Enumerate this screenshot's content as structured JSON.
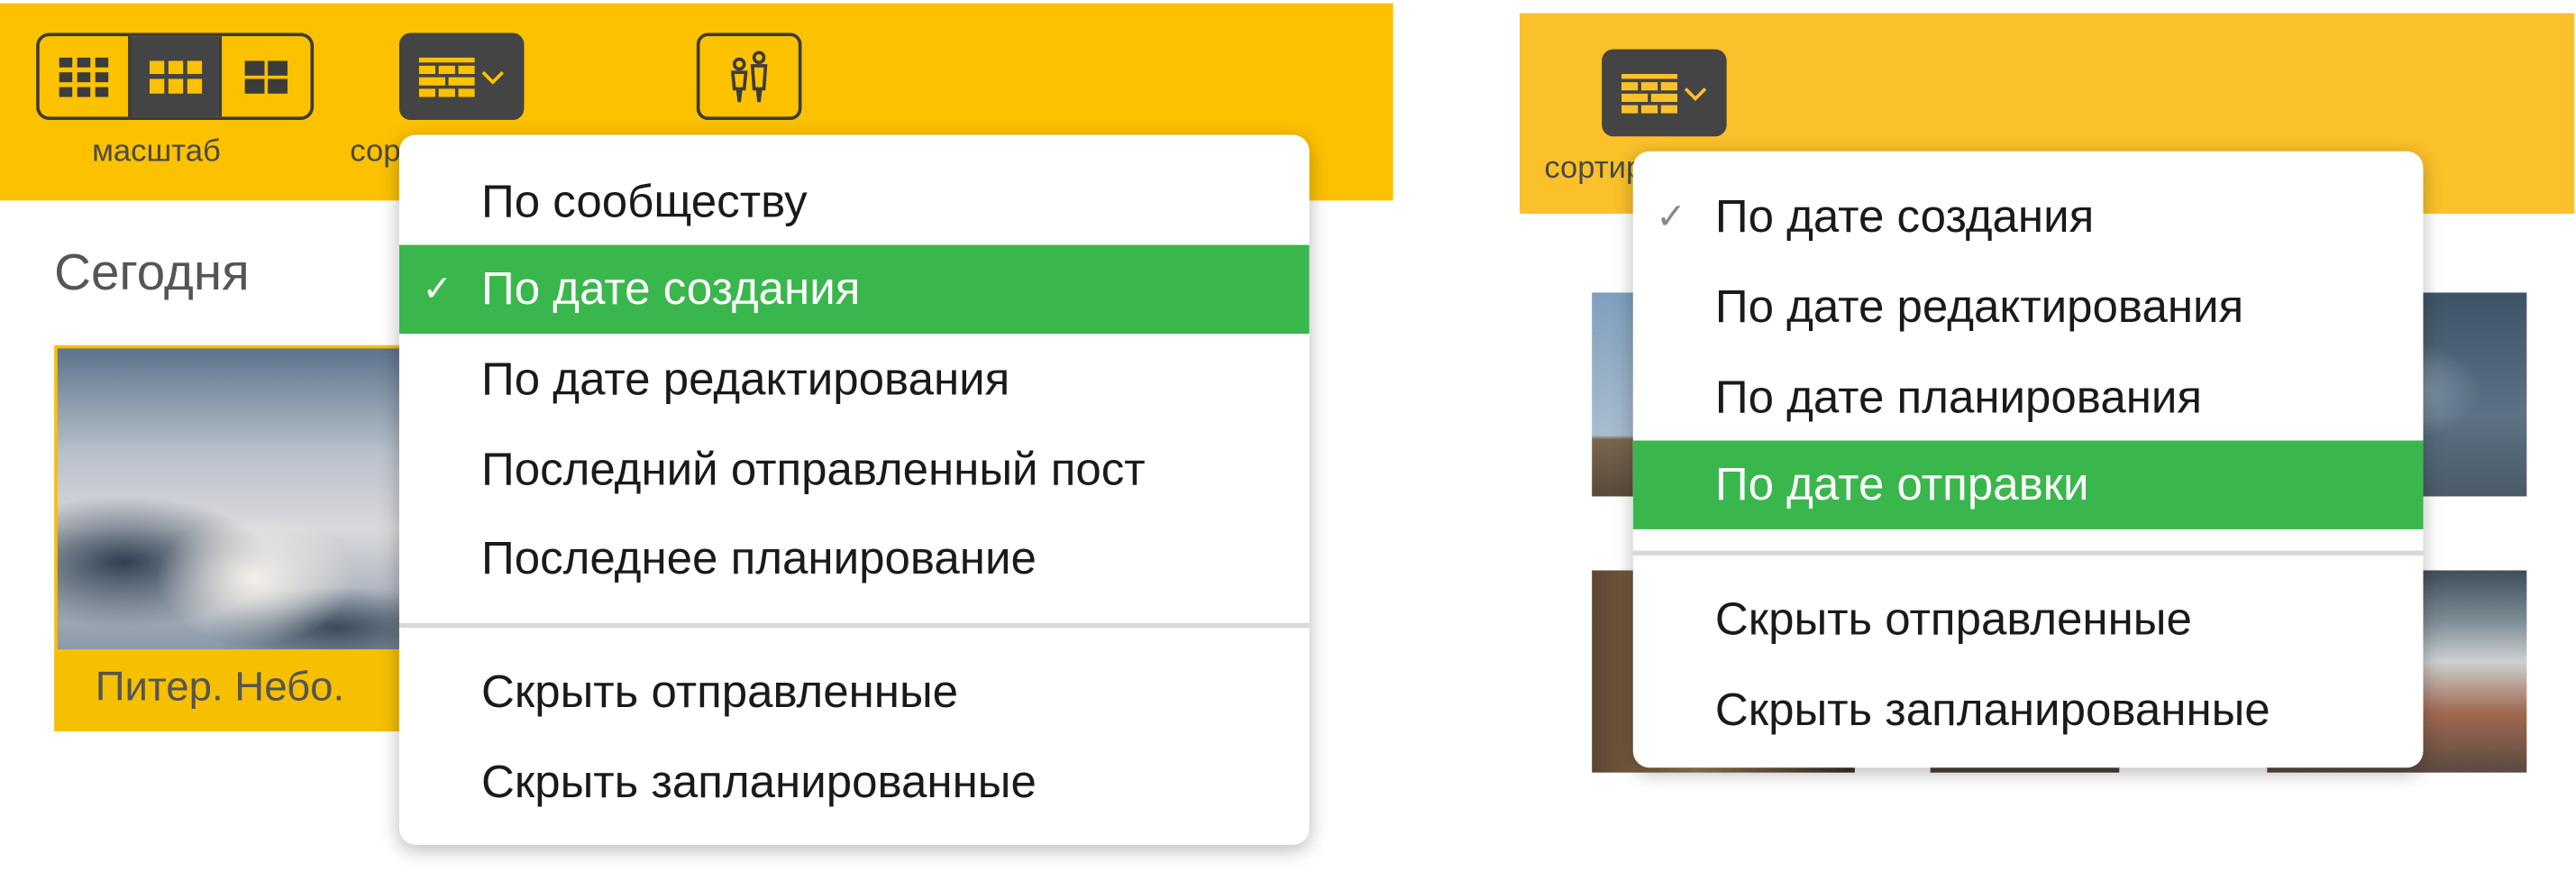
{
  "left": {
    "toolbar": {
      "scale_label": "масштаб",
      "sort_label": "сортировка",
      "active_scale_segment": 1
    },
    "section_title": "Сегодня",
    "card": {
      "caption": "Питер. Небо."
    },
    "sort_menu": {
      "items": [
        {
          "label": "По сообществу",
          "checked": false,
          "highlighted": false
        },
        {
          "label": "По дате создания",
          "checked": true,
          "highlighted": true
        },
        {
          "label": "По дате редактирования",
          "checked": false,
          "highlighted": false
        },
        {
          "label": "Последний отправленный пост",
          "checked": false,
          "highlighted": false
        },
        {
          "label": "Последнее планирование",
          "checked": false,
          "highlighted": false
        }
      ],
      "filters": [
        "Скрыть отправленные",
        "Скрыть запланированные"
      ]
    }
  },
  "right": {
    "toolbar": {
      "sort_label": "сортировка"
    },
    "sort_menu": {
      "items": [
        {
          "label": "По дате создания",
          "checked": true,
          "highlighted": false
        },
        {
          "label": "По дате редактирования",
          "checked": false,
          "highlighted": false
        },
        {
          "label": "По дате планирования",
          "checked": false,
          "highlighted": false
        },
        {
          "label": "По дате отправки",
          "checked": false,
          "highlighted": true
        }
      ],
      "filters": [
        "Скрыть отправленные",
        "Скрыть запланированные"
      ]
    }
  },
  "check_glyph": "✓",
  "colors": {
    "toolbar": "#fcc200",
    "highlight": "#3ab74c",
    "button_dark": "#444444"
  },
  "icons": [
    "grid-small-icon",
    "grid-medium-icon",
    "grid-large-icon",
    "sort-grid-icon",
    "chevron-down-icon",
    "people-icon"
  ]
}
